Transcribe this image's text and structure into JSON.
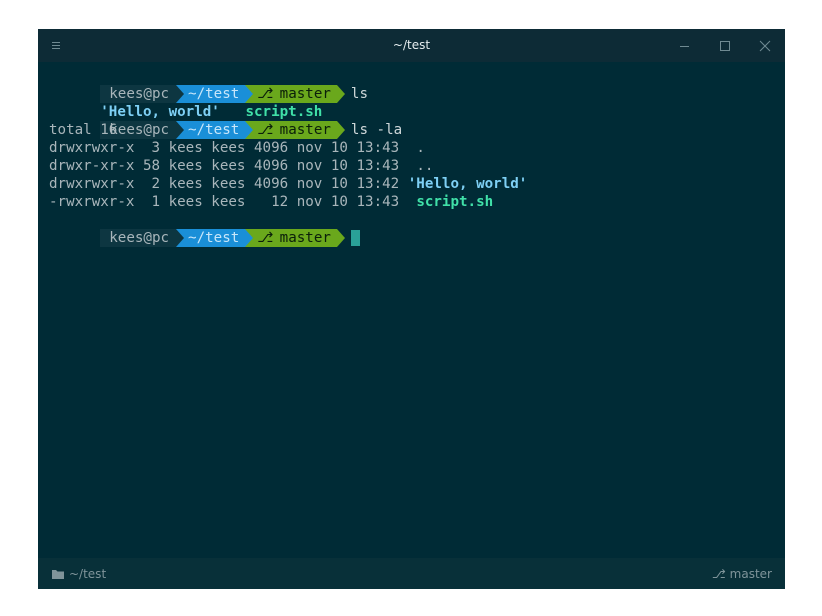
{
  "window": {
    "title": "~/test"
  },
  "icons": {
    "menu": "hamburger-icon",
    "minimize": "minimize-icon",
    "maximize": "maximize-icon",
    "close": "close-icon",
    "folder": "folder-icon",
    "branch": "git-branch-icon"
  },
  "colors": {
    "terminal_bg": "#002b36",
    "prompt_user_bg": "#0d3641",
    "prompt_path_bg": "#1a8fd8",
    "prompt_branch_bg": "#6aa81c",
    "directory": "#7ed0f5",
    "executable": "#40e0a8",
    "cursor": "#2aa198"
  },
  "prompt": {
    "user": "kees@pc",
    "path": "~/test",
    "branch": "master"
  },
  "lines": {
    "cmd1": "ls",
    "out1_dir": "'Hello, world'",
    "out1_exe": "script.sh",
    "cmd2": "ls -la",
    "total": "total 16",
    "row1_meta": "drwxrwxr-x  3 kees kees 4096 nov 10 13:43",
    "row1_name": ".",
    "row2_meta": "drwxr-xr-x 58 kees kees 4096 nov 10 13:43",
    "row2_name": "..",
    "row3_meta": "drwxrwxr-x  2 kees kees 4096 nov 10 13:42",
    "row3_name": "'Hello, world'",
    "row4_meta": "-rwxrwxr-x  1 kees kees   12 nov 10 13:43",
    "row4_name": "script.sh"
  },
  "status": {
    "path": "~/test",
    "branch": "master"
  }
}
